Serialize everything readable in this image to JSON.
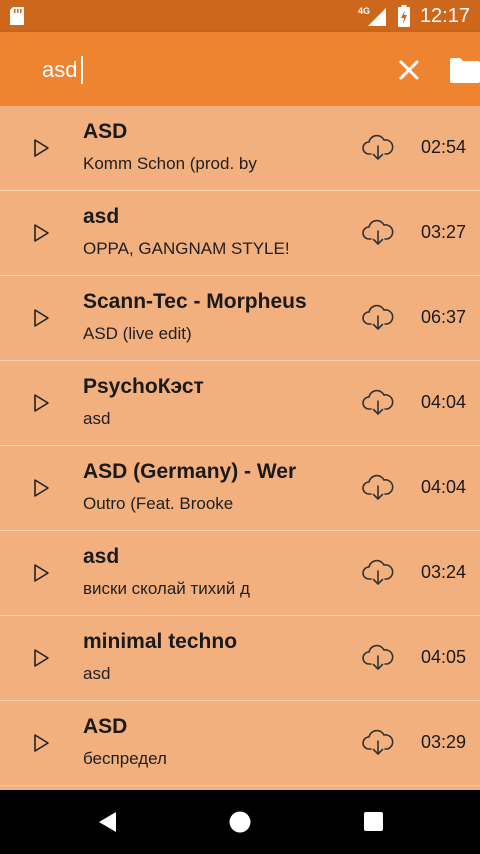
{
  "status_bar": {
    "time": "12:17",
    "network": "4G",
    "icons": [
      "sd-card-icon",
      "signal-icon",
      "battery-charging-icon"
    ]
  },
  "search": {
    "value": "asd",
    "placeholder": ""
  },
  "toolbar": {
    "clear_icon": "close-icon",
    "folder_icon": "folder-icon"
  },
  "colors": {
    "status_bar": "#cc671c",
    "toolbar": "#ee8330",
    "list_background": "#f3b07f",
    "divider": "#f8d2b4",
    "nav_bar": "#000000"
  },
  "tracks": [
    {
      "title": "ASD",
      "artist": "Komm Schon (prod. by",
      "duration": "02:54"
    },
    {
      "title": "asd",
      "artist": "OPPA, GANGNAM STYLE!",
      "duration": "03:27"
    },
    {
      "title": "Scann-Tec - Morpheus",
      "artist": "ASD (live edit)",
      "duration": "06:37"
    },
    {
      "title": "PsychoКэст",
      "artist": "asd",
      "duration": "04:04"
    },
    {
      "title": "ASD (Germany) - Wer",
      "artist": "Outro (Feat. Brooke",
      "duration": "04:04"
    },
    {
      "title": "asd",
      "artist": "виски сколай тихий д",
      "duration": "03:24"
    },
    {
      "title": "minimal techno",
      "artist": "asd",
      "duration": "04:05"
    },
    {
      "title": "ASD",
      "artist": "беспредел",
      "duration": "03:29"
    }
  ],
  "nav_bar": {
    "buttons": [
      "back-icon",
      "home-icon",
      "recents-icon"
    ]
  }
}
